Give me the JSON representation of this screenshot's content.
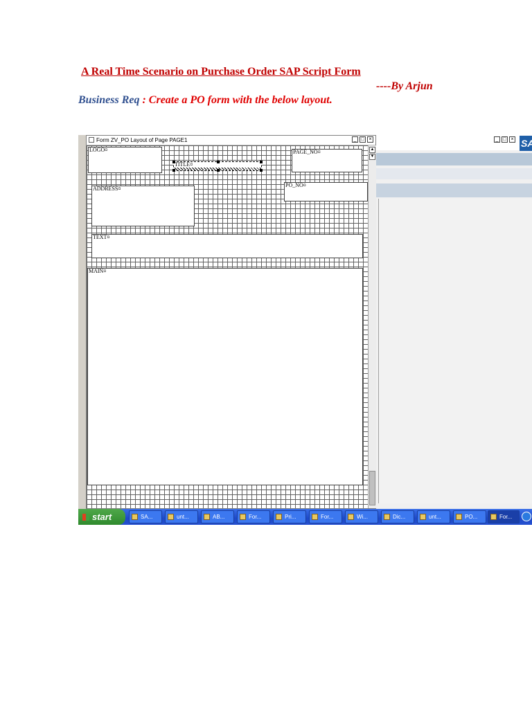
{
  "document": {
    "title": "A Real Time Scenario on  Purchase Order SAP Script Form",
    "author": "----By Arjun",
    "business_label": "Business Req",
    "business_text": " : Create a PO form with the below layout."
  },
  "form_painter": {
    "window_title": "Form ZV_PO   Layout of Page PAGE1",
    "windows": {
      "logo": "LOGO¤",
      "title": "TITLE¤",
      "page_no": "PAGE_NO¤",
      "address": "ADDRESS¤",
      "po_no": "PO_NO¤",
      "text": "TEXT¤",
      "main": "MAIN¤"
    }
  },
  "right_window": {
    "logo_text": "SA"
  },
  "taskbar": {
    "start_label": "start",
    "items": [
      {
        "label": "SA..."
      },
      {
        "label": "unt..."
      },
      {
        "label": "AB..."
      },
      {
        "label": "For..."
      },
      {
        "label": "Pri..."
      },
      {
        "label": "For..."
      },
      {
        "label": "Wi..."
      },
      {
        "label": "Dic..."
      },
      {
        "label": "unt..."
      },
      {
        "label": "PO..."
      },
      {
        "label": "For..."
      }
    ]
  }
}
